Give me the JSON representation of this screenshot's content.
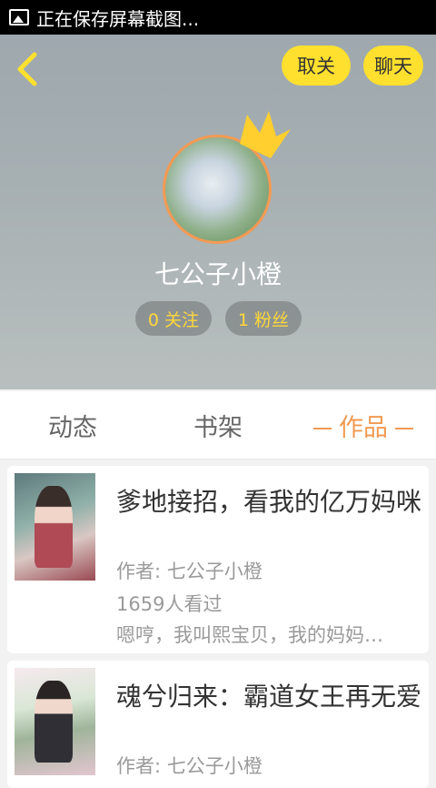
{
  "status_bar": {
    "notification": "正在保存屏幕截图..."
  },
  "header": {
    "back_icon": "chevron-left-icon",
    "unfollow_label": "取关",
    "chat_label": "聊天",
    "username": "七公子小橙",
    "following": "0 关注",
    "fans": "1 粉丝",
    "accent_color": "#ffe02e"
  },
  "tabs": [
    {
      "label": "动态",
      "active": false
    },
    {
      "label": "书架",
      "active": false
    },
    {
      "label": "作品",
      "active": true
    }
  ],
  "works": [
    {
      "title": "爹地接招，看我的亿万妈咪",
      "author": "作者: 七公子小橙",
      "views": "1659人看过",
      "description": "嗯哼，我叫熙宝贝，我的妈妈…"
    },
    {
      "title": "魂兮归来：霸道女王再无爱",
      "author": "作者: 七公子小橙"
    }
  ]
}
